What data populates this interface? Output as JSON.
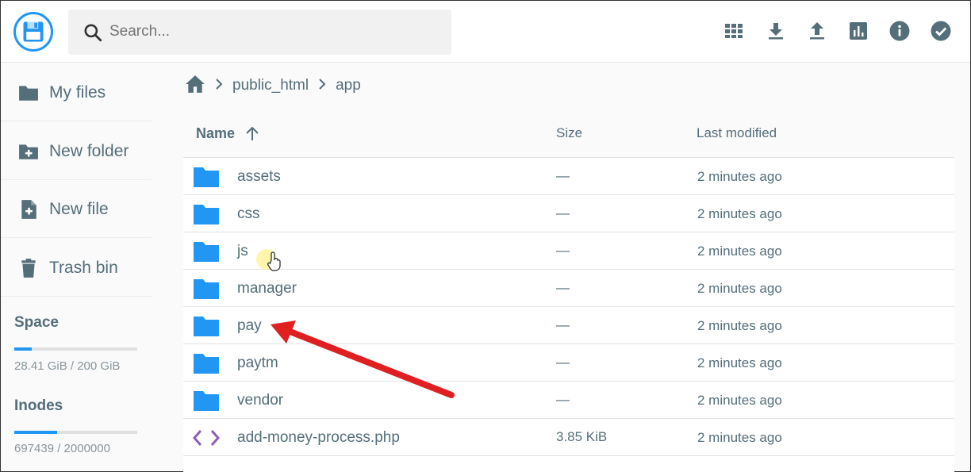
{
  "header": {
    "search_placeholder": "Search...",
    "icons": [
      "logo-disk-icon",
      "search-icon",
      "grid-view-icon",
      "download-icon",
      "upload-icon",
      "chart-icon",
      "info-icon",
      "select-check-icon"
    ]
  },
  "sidebar": {
    "items": [
      {
        "label": "My files",
        "icon": "folder-icon"
      },
      {
        "label": "New folder",
        "icon": "folder-plus-icon"
      },
      {
        "label": "New file",
        "icon": "file-plus-icon"
      },
      {
        "label": "Trash bin",
        "icon": "trash-icon"
      }
    ],
    "space": {
      "title": "Space",
      "value": "28.41 GiB / 200 GiB",
      "fraction": 0.142
    },
    "inodes": {
      "title": "Inodes",
      "value": "697439 / 2000000",
      "fraction": 0.349
    }
  },
  "breadcrumb": {
    "items": [
      "public_html",
      "app"
    ],
    "home_icon": "home-icon"
  },
  "table": {
    "headers": {
      "name": "Name",
      "size": "Size",
      "modified": "Last modified"
    },
    "sort_icon": "arrow-up-icon",
    "rows": [
      {
        "name": "assets",
        "size": "—",
        "modified": "2 minutes ago",
        "type": "folder"
      },
      {
        "name": "css",
        "size": "—",
        "modified": "2 minutes ago",
        "type": "folder"
      },
      {
        "name": "js",
        "size": "—",
        "modified": "2 minutes ago",
        "type": "folder"
      },
      {
        "name": "manager",
        "size": "—",
        "modified": "2 minutes ago",
        "type": "folder"
      },
      {
        "name": "pay",
        "size": "—",
        "modified": "2 minutes ago",
        "type": "folder"
      },
      {
        "name": "paytm",
        "size": "—",
        "modified": "2 minutes ago",
        "type": "folder"
      },
      {
        "name": "vendor",
        "size": "—",
        "modified": "2 minutes ago",
        "type": "folder"
      },
      {
        "name": "add-money-process.php",
        "size": "3.85 KiB",
        "modified": "2 minutes ago",
        "type": "code"
      }
    ]
  },
  "colors": {
    "accent": "#2196f3",
    "folder": "#2196f3",
    "code": "#8e5fb5",
    "text": "#546e7a",
    "annotation_arrow": "#e02020",
    "cursor_highlight": "#fff59d"
  }
}
